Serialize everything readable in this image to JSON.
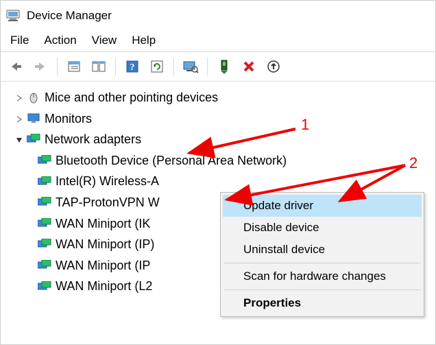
{
  "window": {
    "title": "Device Manager"
  },
  "menubar": {
    "file": "File",
    "action": "Action",
    "view": "View",
    "help": "Help"
  },
  "toolbar": {
    "back": "back",
    "forward": "forward",
    "show_hidden": "show-hidden",
    "devices": "devices-by-type",
    "help": "help",
    "refresh": "refresh",
    "scan": "scan-hardware",
    "enable": "enable-device",
    "disable": "remove-device",
    "update": "update-driver"
  },
  "tree": {
    "collapsed": [
      {
        "label": "Mice and other pointing devices",
        "icon_name": "mouse-icon"
      },
      {
        "label": "Monitors",
        "icon_name": "monitor-icon"
      }
    ],
    "expanded": {
      "label": "Network adapters",
      "icon_name": "network-adapter-icon",
      "children": [
        "Bluetooth Device (Personal Area Network)",
        "Intel(R) Wireless-A",
        "TAP-ProtonVPN W",
        "WAN Miniport (IK",
        "WAN Miniport (IP)",
        "WAN Miniport (IP",
        "WAN Miniport (L2"
      ]
    }
  },
  "context_menu": {
    "update": "Update driver",
    "disable": "Disable device",
    "uninstall": "Uninstall device",
    "scan": "Scan for hardware changes",
    "properties": "Properties"
  },
  "annotations": {
    "one": "1",
    "two": "2"
  }
}
